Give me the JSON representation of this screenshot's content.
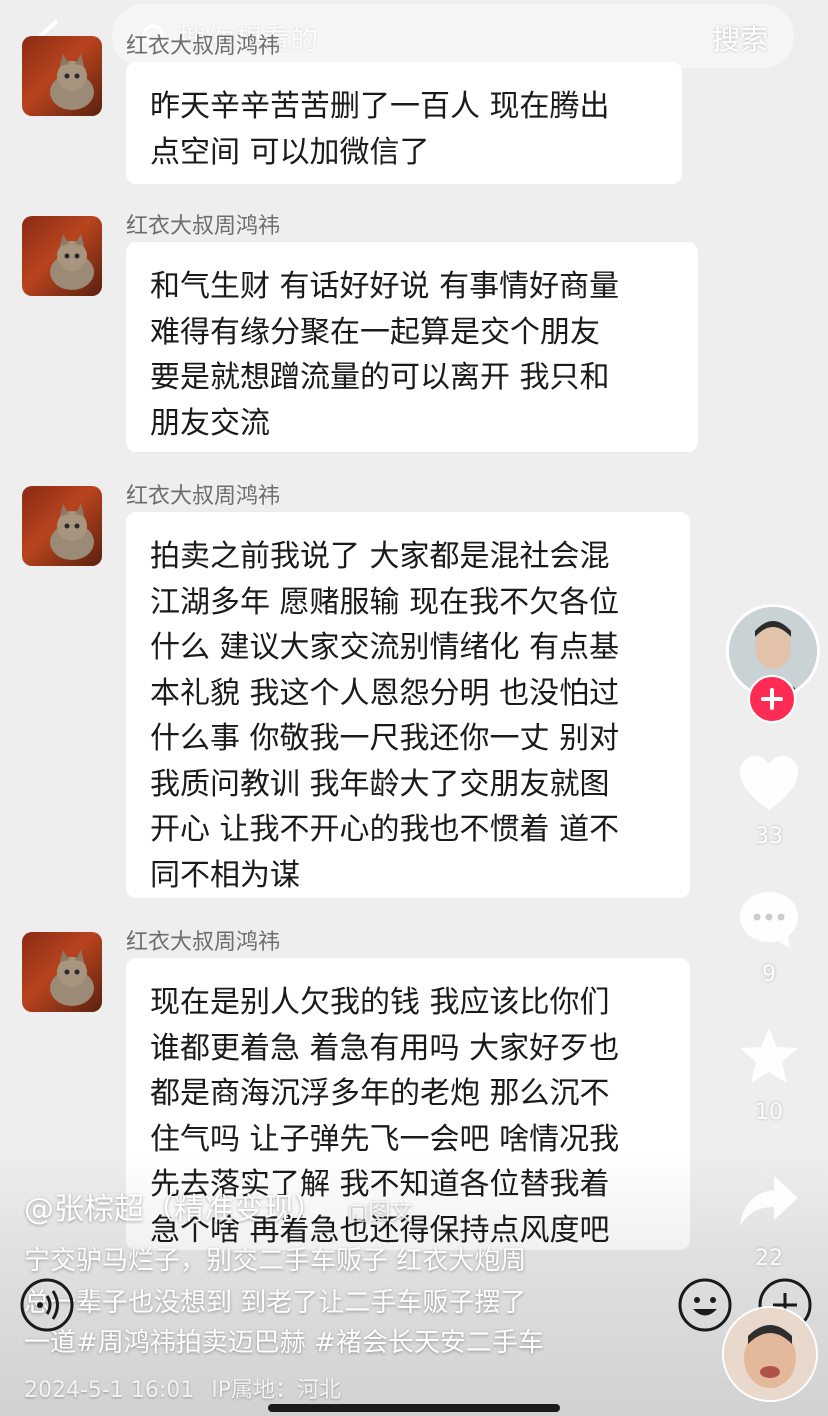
{
  "search": {
    "placeholder": "搜你想看的",
    "button_label": "搜索"
  },
  "messages": [
    {
      "sender": "红衣大叔周鸿祎",
      "text": "昨天辛辛苦苦删了一百人 现在腾出\n点空间 可以加微信了"
    },
    {
      "sender": "红衣大叔周鸿祎",
      "text": "和气生财 有话好好说 有事情好商量\n难得有缘分聚在一起算是交个朋友\n要是就想蹭流量的可以离开 我只和\n朋友交流"
    },
    {
      "sender": "红衣大叔周鸿祎",
      "text": "拍卖之前我说了 大家都是混社会混\n江湖多年 愿赌服输 现在我不欠各位\n什么 建议大家交流别情绪化 有点基\n本礼貌 我这个人恩怨分明 也没怕过\n什么事 你敬我一尺我还你一丈 别对\n我质问教训 我年龄大了交朋友就图\n开心 让我不开心的我也不惯着 道不\n同不相为谋"
    },
    {
      "sender": "红衣大叔周鸿祎",
      "text": "现在是别人欠我的钱 我应该比你们\n谁都更着急 着急有用吗 大家好歹也\n都是商海沉浮多年的老炮 那么沉不\n住气吗 让子弹先飞一会吧 啥情况我\n先去落实了解 我不知道各位替我着\n急个啥 再着急也还得保持点风度吧"
    }
  ],
  "rail": {
    "likes": "33",
    "comments": "9",
    "favorites": "10",
    "shares": "22"
  },
  "post": {
    "author": "@张棕超（精准变现）",
    "type_tag": "图文",
    "caption_lines": [
      "宁交驴马烂子，别交二手车贩子 红衣大炮周",
      "总一辈子也没想到 到老了让二手车贩子摆了",
      "一道#周鸿祎拍卖迈巴赫 #褚会长天安二手车"
    ],
    "date": "2024-5-1 16:01",
    "ip_location": "IP属地：河北"
  },
  "colors": {
    "accent": "#fe2c55",
    "bubble": "#ffffff",
    "background": "#eeeeee"
  }
}
